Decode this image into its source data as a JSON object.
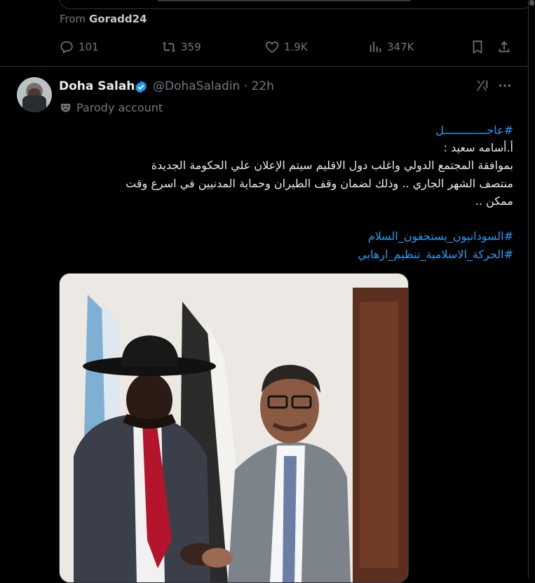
{
  "previous_tweet": {
    "from_prefix": "From",
    "from_user": "Goradd24",
    "replies": "101",
    "reposts": "359",
    "likes": "1.9K",
    "views": "347K"
  },
  "tweet": {
    "display_name": "Doha Salah",
    "handle_time": "@DohaSaladin · 22h",
    "label": "Parody account",
    "lines": [
      {
        "text": "#عاجـــــــــــــل",
        "tag": true
      },
      {
        "text": "أ.أسامه سعيد :",
        "tag": false
      },
      {
        "text": "بموافقة المجتمع الدولي واغلب دول الاقليم سيتم الإعلان علي الحكومة الجديدة",
        "tag": false
      },
      {
        "text": "منتصف الشهر الجاري ..  وذلك لضمان وقف الطيران وحماية المدنيين في اسرع وقت",
        "tag": false
      },
      {
        "text": "ممكن ..",
        "tag": false
      },
      {
        "text": "#السودانيون_يستحقون_السلام",
        "tag": true
      },
      {
        "text": "#الحركة_الاسلامية_تنظيم_ارهابي",
        "tag": true
      }
    ]
  },
  "colors": {
    "accent": "#1d9bf0",
    "muted": "#71767b",
    "text": "#e7e9ea",
    "border": "#2f3336"
  }
}
